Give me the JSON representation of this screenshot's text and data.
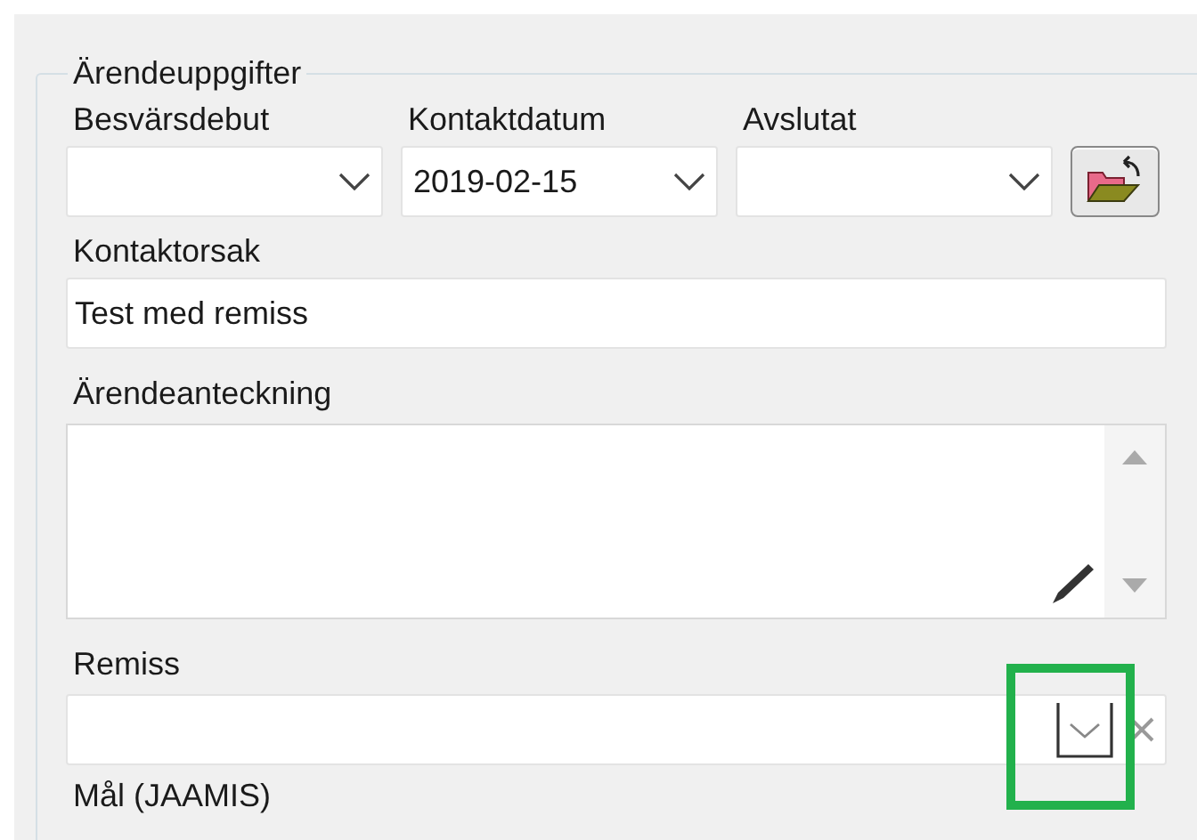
{
  "group": {
    "title": "Ärendeuppgifter"
  },
  "date_fields": [
    {
      "label": "Besvärsdebut"
    },
    {
      "label": "Kontaktdatum",
      "value": "2019-02-15"
    },
    {
      "label": "Avslutat"
    }
  ],
  "contact_reason": {
    "label": "Kontaktorsak",
    "value": "Test med remiss"
  },
  "case_note": {
    "label": "Ärendeanteckning"
  },
  "referral": {
    "label": "Remiss",
    "highlighted": true
  },
  "next_label": "Mål (JAAMIS)"
}
